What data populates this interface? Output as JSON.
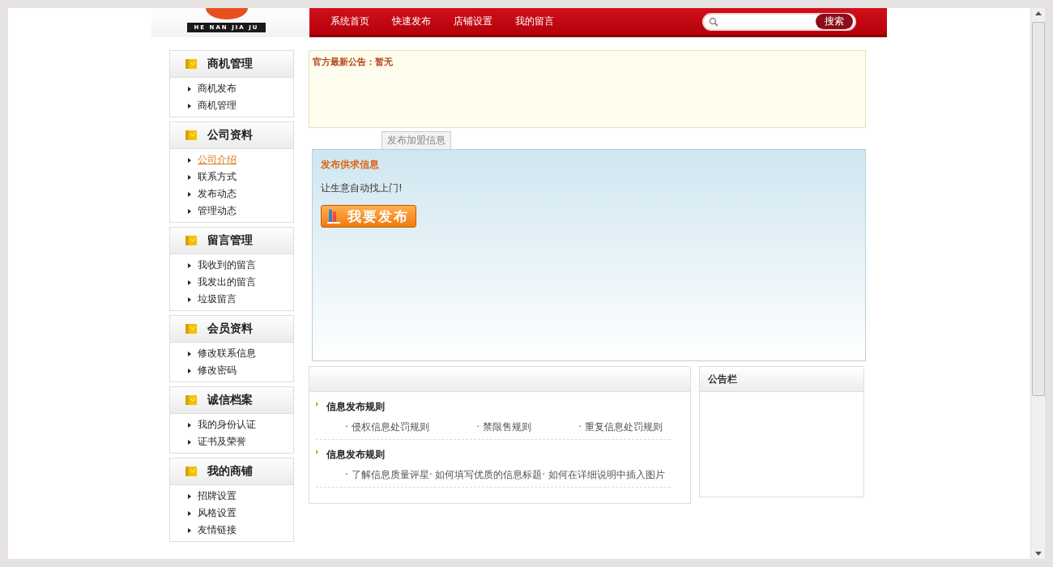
{
  "logo": {
    "text": "HE NAN JIA JU"
  },
  "nav": [
    {
      "label": "系统首页"
    },
    {
      "label": "快速发布"
    },
    {
      "label": "店铺设置"
    },
    {
      "label": "我的留言"
    }
  ],
  "search": {
    "button": "搜索"
  },
  "sidebar": [
    {
      "title": "商机管理",
      "items": [
        {
          "label": "商机发布",
          "selected": false
        },
        {
          "label": "商机管理",
          "selected": false
        }
      ]
    },
    {
      "title": "公司资料",
      "items": [
        {
          "label": "公司介绍",
          "selected": true
        },
        {
          "label": "联系方式",
          "selected": false
        },
        {
          "label": "发布动态",
          "selected": false
        },
        {
          "label": "管理动态",
          "selected": false
        }
      ]
    },
    {
      "title": "留言管理",
      "items": [
        {
          "label": "我收到的留言",
          "selected": false
        },
        {
          "label": "我发出的留言",
          "selected": false
        },
        {
          "label": "垃圾留言",
          "selected": false
        }
      ]
    },
    {
      "title": "会员资料",
      "items": [
        {
          "label": "修改联系信息",
          "selected": false
        },
        {
          "label": "修改密码",
          "selected": false
        }
      ]
    },
    {
      "title": "诚信档案",
      "items": [
        {
          "label": "我的身份认证",
          "selected": false
        },
        {
          "label": "证书及荣誉",
          "selected": false
        }
      ]
    },
    {
      "title": "我的商铺",
      "items": [
        {
          "label": "招牌设置",
          "selected": false
        },
        {
          "label": "风格设置",
          "selected": false
        },
        {
          "label": "友情链接",
          "selected": false
        }
      ]
    }
  ],
  "notice": {
    "label": "官方最新公告：",
    "value": "暂无"
  },
  "tabs": [
    {
      "label": "发布加盟信息",
      "selected": false
    }
  ],
  "publish": {
    "title": "发布供求信息",
    "slogan": "让生意自动找上门!",
    "button": "我要发布"
  },
  "rules": [
    {
      "title": "信息发布规则",
      "links": [
        "· 侵权信息处罚规则",
        "· 禁限售规则",
        "· 重复信息处罚规则"
      ]
    },
    {
      "title": "信息发布规则",
      "links": [
        "· 了解信息质量评星",
        "· 如何填写优质的信息标题",
        "· 如何在详细说明中插入图片"
      ]
    }
  ],
  "board": {
    "title": "公告栏"
  }
}
